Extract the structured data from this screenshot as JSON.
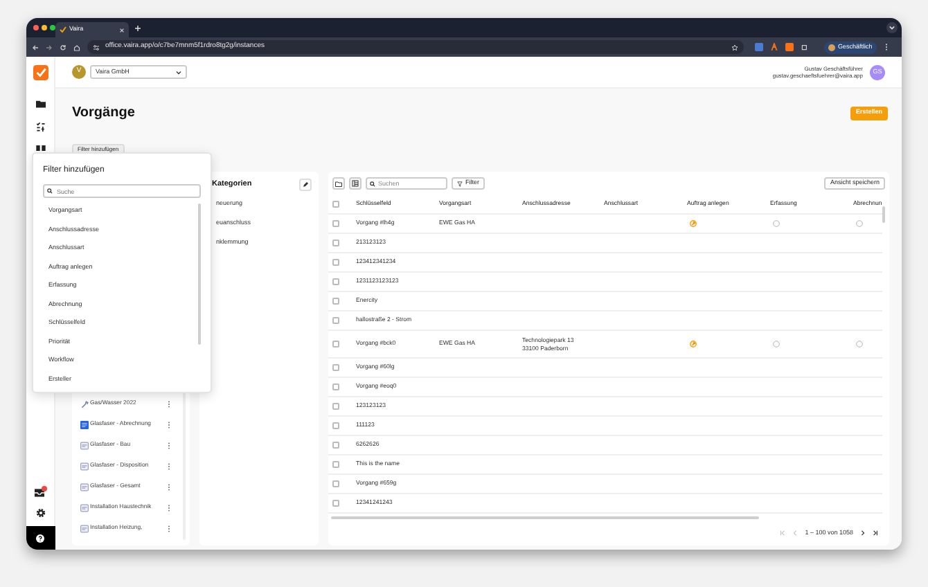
{
  "browser": {
    "tab_title": "Vaira",
    "url": "office.vaira.app/o/c7be7mnm5f1rdro8tg2g/instances",
    "profile": "Geschäftlich"
  },
  "header": {
    "org_initial": "V",
    "org_select": "Vaira GmbH",
    "user_name": "Gustav Geschäftsführer",
    "user_email": "gustav.geschaeftsfuehrer@vaira.app",
    "user_initials": "GS"
  },
  "page": {
    "title": "Vorgänge",
    "create_button": "Erstellen",
    "filter_button": "Filter hinzufügen"
  },
  "filter_popover": {
    "title": "Filter hinzufügen",
    "search_placeholder": "Suche",
    "options": [
      "Vorgangsart",
      "Anschlussadresse",
      "Anschlussart",
      "Auftrag anlegen",
      "Erfassung",
      "Abrechnung",
      "Schlüsselfeld",
      "Priorität",
      "Workflow",
      "Ersteller"
    ]
  },
  "categories_panel": {
    "title": "Kategorien",
    "items": [
      "neuerung",
      "euanschluss",
      "nklemmung"
    ]
  },
  "workflows": [
    {
      "label": "Gas/Wasser 2022",
      "kind": "tool"
    },
    {
      "label": "Glasfaser - Abrechnung",
      "kind": "custom"
    },
    {
      "label": "Glasfaser - Bau",
      "kind": "default"
    },
    {
      "label": "Glasfaser - Disposition",
      "kind": "default"
    },
    {
      "label": "Glasfaser - Gesamt",
      "kind": "default"
    },
    {
      "label": "Installation Haustechnik",
      "kind": "default"
    },
    {
      "label": "Installation Heizung,",
      "kind": "default"
    }
  ],
  "table": {
    "search_placeholder": "Suchen",
    "filter_button": "Filter",
    "save_view_button": "Ansicht speichern",
    "select_all_checked": false,
    "columns": [
      "Schlüsselfeld",
      "Vorgangsart",
      "Anschlussadresse",
      "Anschlussart",
      "Auftrag anlegen",
      "Erfassung",
      "Abrechnun"
    ],
    "rows": [
      {
        "checked": false,
        "schluesselfeld": "Vorgang #lh4g",
        "vorgangsart": "EWE Gas HA",
        "steps": [
          {
            "started": true
          },
          {
            "started": false
          },
          {
            "started": false
          }
        ]
      },
      {
        "checked": false,
        "schluesselfeld": "213123123"
      },
      {
        "checked": false,
        "schluesselfeld": "123412341234"
      },
      {
        "checked": false,
        "schluesselfeld": "1231123123123"
      },
      {
        "checked": false,
        "schluesselfeld": "Enercity"
      },
      {
        "checked": false,
        "schluesselfeld": "hallostraße 2 - Strom"
      },
      {
        "checked": false,
        "schluesselfeld": "Vorgang #bck0",
        "vorgangsart": "EWE Gas HA",
        "anschlussadresse": [
          "Technologiepark 13",
          "33100 Paderborn"
        ],
        "steps": [
          {
            "started": true
          },
          {
            "started": false
          },
          {
            "started": false
          }
        ]
      },
      {
        "checked": false,
        "schluesselfeld": "Vorgang #60lg"
      },
      {
        "checked": false,
        "schluesselfeld": "Vorgang #eoq0"
      },
      {
        "checked": false,
        "schluesselfeld": "123123123"
      },
      {
        "checked": false,
        "schluesselfeld": "111123"
      },
      {
        "checked": false,
        "schluesselfeld": "6262626"
      },
      {
        "checked": false,
        "schluesselfeld": "This is the name"
      },
      {
        "checked": false,
        "schluesselfeld": "Vorgang #659g"
      },
      {
        "checked": false,
        "schluesselfeld": "12341241243"
      }
    ],
    "pagination": "1 – 100 von 1058"
  }
}
